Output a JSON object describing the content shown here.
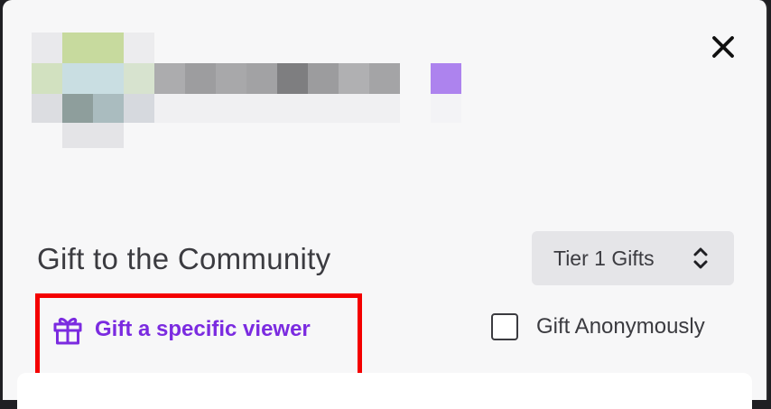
{
  "modal": {
    "close_icon": "close-icon"
  },
  "section": {
    "title": "Gift to the Community"
  },
  "tier_select": {
    "selected": "Tier 1 Gifts",
    "icon": "chevron-up-down-icon"
  },
  "gift_specific": {
    "label": "Gift a specific viewer",
    "icon": "gift-icon",
    "color": "#7b2be0"
  },
  "anonymous": {
    "label": "Gift Anonymously",
    "checked": false
  },
  "colors": {
    "accent": "#7b2be0",
    "highlight": "#f40000",
    "background": "#f7f7f8"
  }
}
